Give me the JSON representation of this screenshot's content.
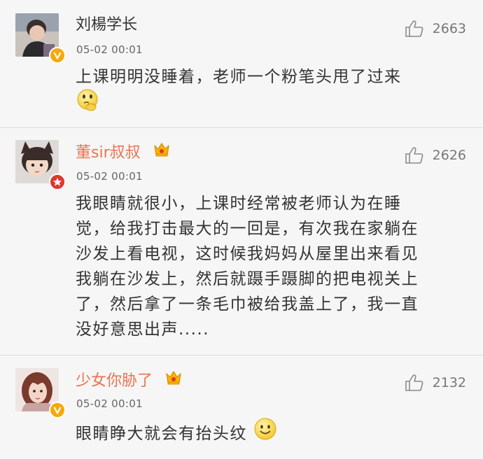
{
  "comments": [
    {
      "username": "刘楊学长",
      "timestamp": "05-02 00:01",
      "likes": "2663",
      "text": "上课明明没睡着，老师一个粉笔头甩了过来",
      "avatar": "child-photo-avatar",
      "badge": "v-badge-icon",
      "emoji": "thinking-face-emoji"
    },
    {
      "username": "董sir叔叔",
      "timestamp": "05-02 00:01",
      "likes": "2626",
      "text_lines": [
        "我眼睛就很小，上课时经常被老师认为在睡",
        "觉，给我打击最大的一回是，有次我在家躺在",
        "沙发上看电视，这时候我妈妈从屋里出来看见",
        "我躺在沙发上，然后就蹑手蹑脚的把电视关上",
        "了，然后拿了一条毛巾被给我盖上了，我一直",
        "没好意思出声....."
      ],
      "avatar": "cat-ears-child-avatar",
      "badge": "red-star-badge-icon",
      "member_icon": "crown-icon"
    },
    {
      "username": "少女你胁了",
      "timestamp": "05-02 00:01",
      "likes": "2132",
      "text": "眼睛睁大就会有抬头纹",
      "avatar": "girl-photo-avatar",
      "badge": "v-badge-icon",
      "member_icon": "crown-icon",
      "emoji": "smile-face-emoji"
    }
  ],
  "colors": {
    "background": "#f6f6f6",
    "username_default": "#333333",
    "username_member": "#eb7350",
    "badge_verified": "#f6a80c",
    "badge_star": "#e0362d",
    "divider": "#dcdcdc"
  }
}
